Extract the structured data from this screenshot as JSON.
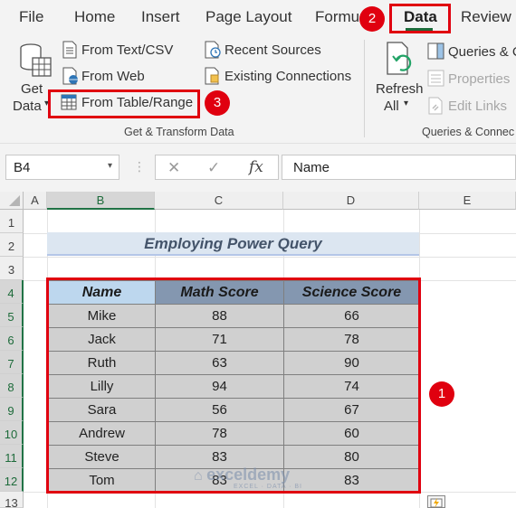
{
  "tabs": {
    "file": "File",
    "home": "Home",
    "insert": "Insert",
    "page_layout": "Page Layout",
    "formulas": "Formu",
    "data": "Data",
    "review": "Review"
  },
  "ribbon": {
    "get_data_line1": "Get",
    "get_data_line2": "Data",
    "from_text_csv": "From Text/CSV",
    "from_web": "From Web",
    "from_table_range": "From Table/Range",
    "recent_sources": "Recent Sources",
    "existing_connections": "Existing Connections",
    "group_get_transform": "Get & Transform Data",
    "refresh_line1": "Refresh",
    "refresh_line2": "All",
    "queries_connections": "Queries & C",
    "properties": "Properties",
    "edit_links": "Edit Links",
    "group_queries": "Queries & Connec"
  },
  "formula_bar": {
    "name_box": "B4",
    "cancel_symbol": "✕",
    "enter_symbol": "✓",
    "fx_symbol": "fx",
    "content": "Name"
  },
  "grid": {
    "columns": [
      "A",
      "B",
      "C",
      "D",
      "E"
    ],
    "rows": [
      "1",
      "2",
      "3",
      "4",
      "5",
      "6",
      "7",
      "8",
      "9",
      "10",
      "11",
      "12",
      "13"
    ],
    "title": "Employing Power Query"
  },
  "table": {
    "headers": [
      "Name",
      "Math Score",
      "Science Score"
    ],
    "rows": [
      [
        "Mike",
        "88",
        "66"
      ],
      [
        "Jack",
        "71",
        "78"
      ],
      [
        "Ruth",
        "63",
        "90"
      ],
      [
        "Lilly",
        "94",
        "74"
      ],
      [
        "Sara",
        "56",
        "67"
      ],
      [
        "Andrew",
        "78",
        "60"
      ],
      [
        "Steve",
        "83",
        "80"
      ],
      [
        "Tom",
        "83",
        "83"
      ]
    ]
  },
  "badges": {
    "one": "1",
    "two": "2",
    "three": "3"
  },
  "watermark": {
    "name": "exceldemy",
    "tagline": "EXCEL · DATA · BI"
  },
  "colors": {
    "accent_green": "#217346",
    "highlight_red": "#e0000f",
    "header_blue_light": "#bdd7ee",
    "header_blue_dark": "#8497b0",
    "title_fill": "#dce6f1"
  }
}
